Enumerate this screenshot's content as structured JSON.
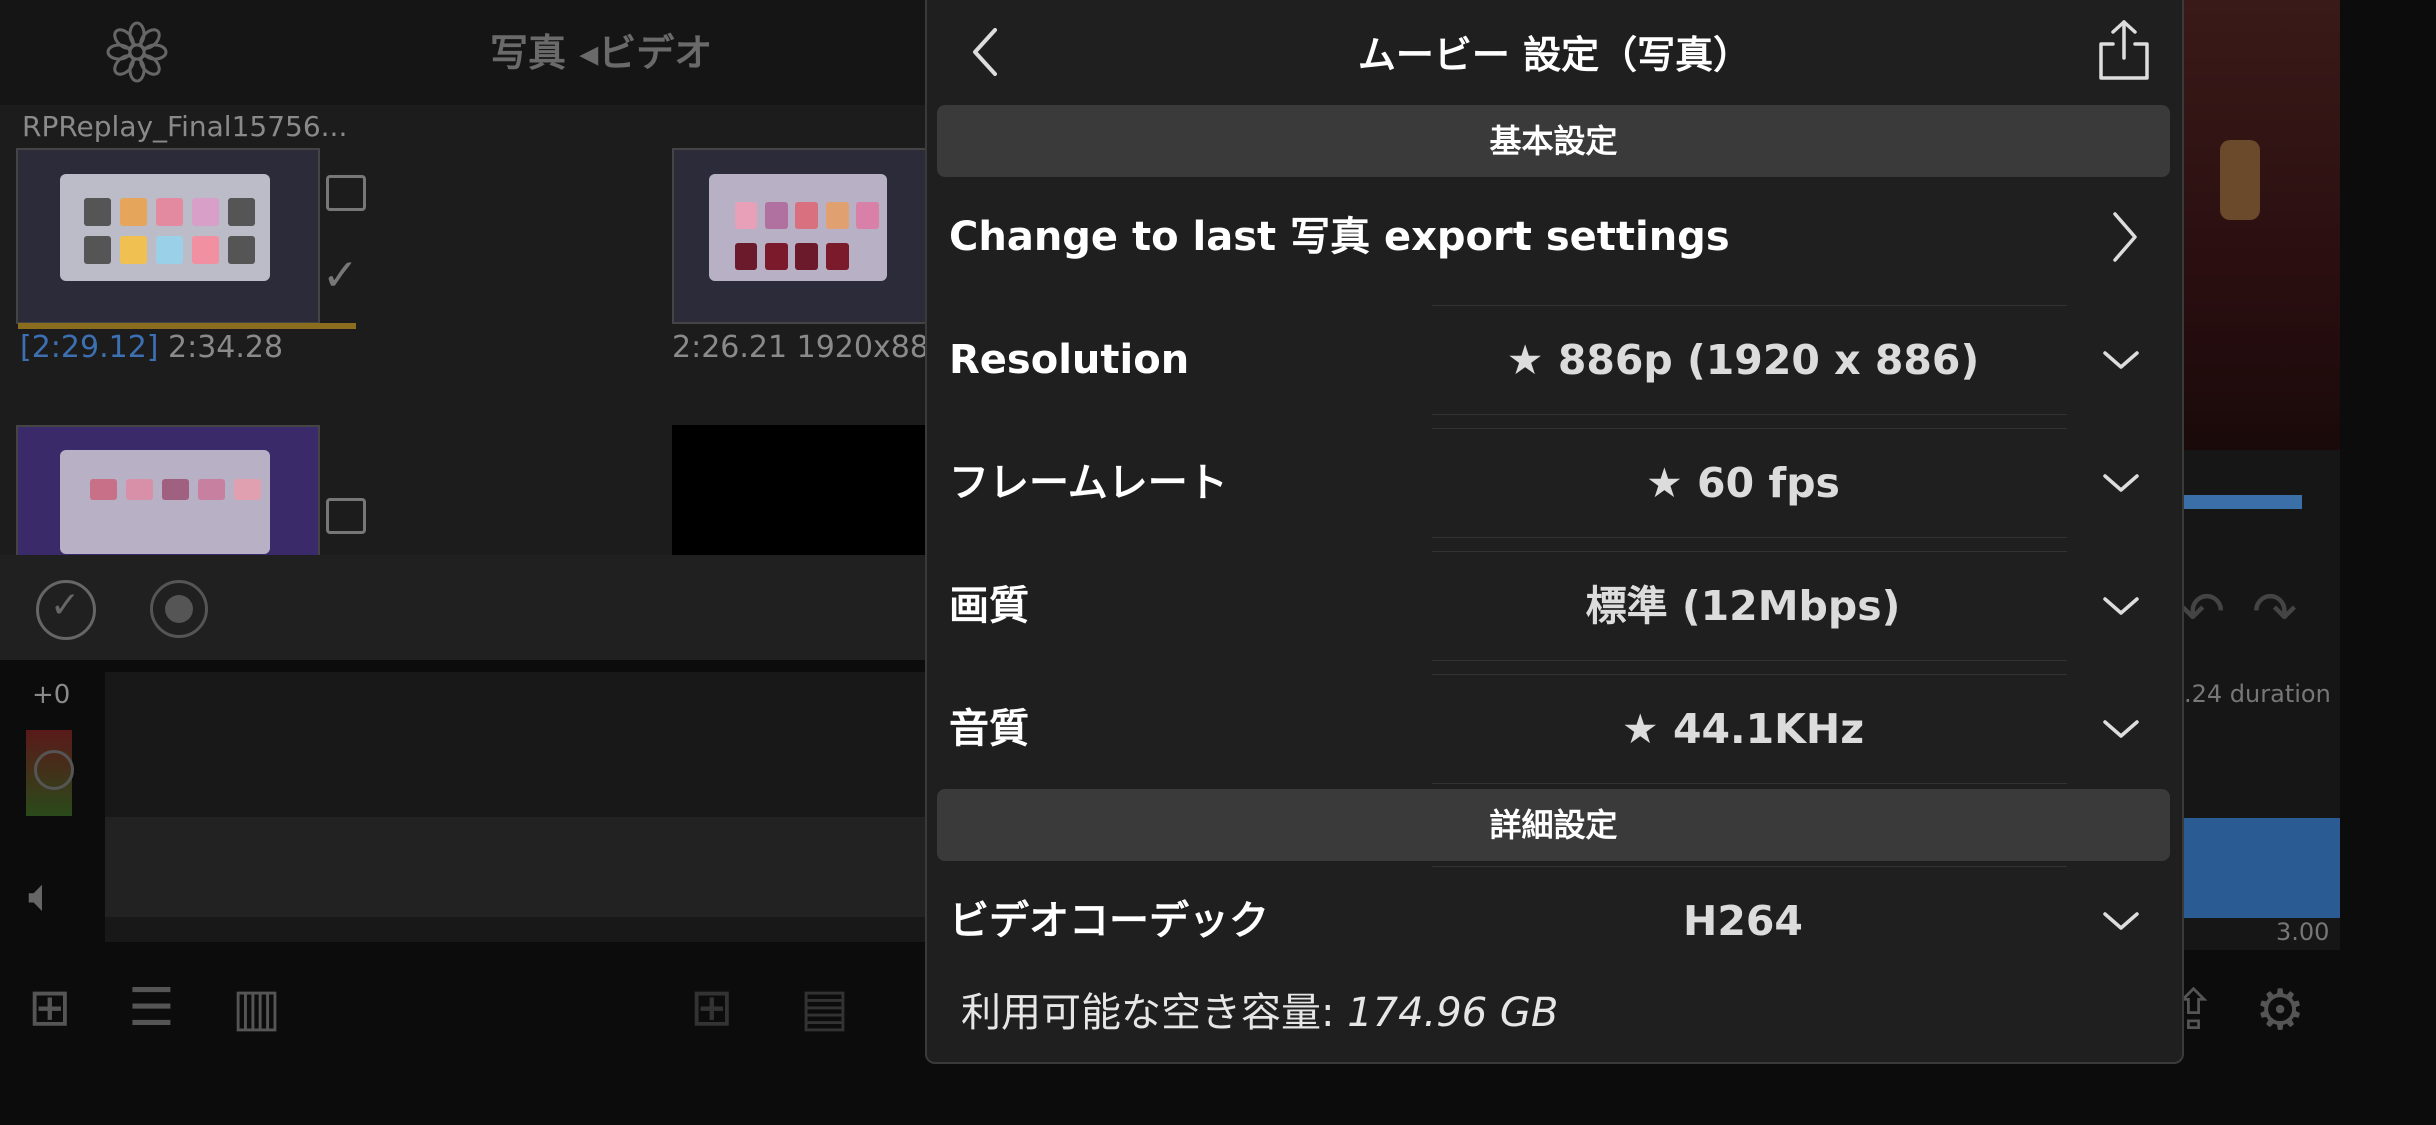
{
  "background": {
    "title_segment": "写真 ◂ビデオ",
    "clip_name": "RPReplay_Final15756...",
    "clip1_in": "[2:29.12]",
    "clip1_duration": "2:34.28",
    "clip2_info": "2:26.21  1920x88",
    "level_offset": "+0",
    "duration_label": ".24 duration",
    "timeline_time": "3.00"
  },
  "modal": {
    "title": "ムービー 設定（写真）",
    "section_basic": "基本設定",
    "last_export_label": "Change to last 写真 export settings",
    "rows": [
      {
        "label": "Resolution",
        "value": "★ 886p (1920 x 886)"
      },
      {
        "label": "フレームレート",
        "value": "★ 60 fps"
      },
      {
        "label": "画質",
        "value": "標準 (12Mbps)"
      },
      {
        "label": "音質",
        "value": "★ 44.1KHz"
      }
    ],
    "section_detail": "詳細設定",
    "codec": {
      "label": "ビデオコーデック",
      "value": "H264"
    },
    "free_space_label": "利用可能な空き容量: ",
    "free_space_value": "174.96 GB"
  }
}
